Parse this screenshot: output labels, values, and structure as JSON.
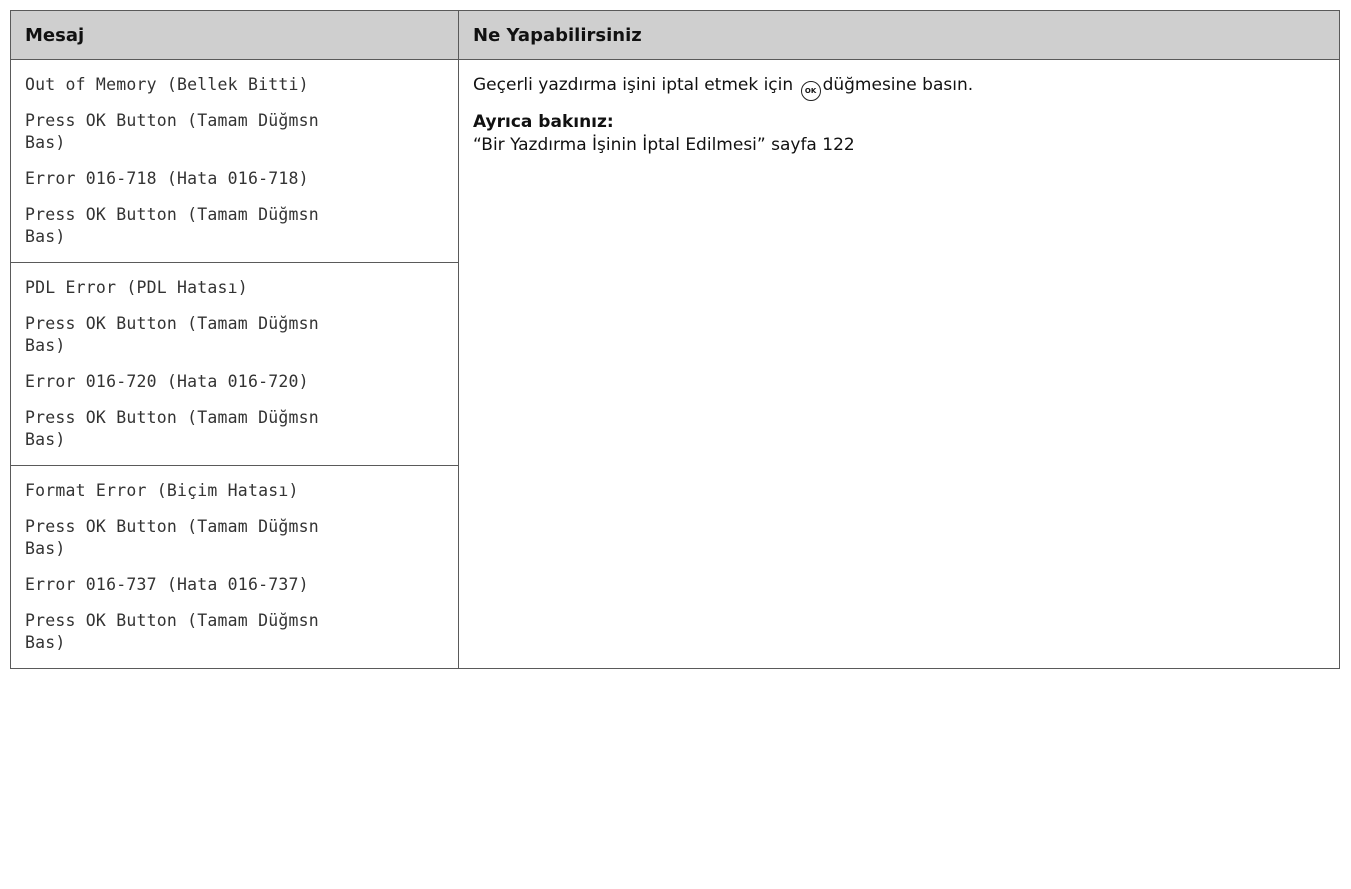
{
  "table": {
    "headers": [
      "Mesaj",
      "Ne Yapabilirsiniz"
    ],
    "groups": [
      {
        "messages": [
          "Out of Memory (Bellek Bitti)",
          "Press OK Button (Tamam Düğmsn Bas)",
          "Error 016-718 (Hata 016-718)",
          "Press OK Button (Tamam Düğmsn Bas)"
        ]
      },
      {
        "messages": [
          "PDL Error (PDL Hatası)",
          "Press OK Button (Tamam Düğmsn Bas)",
          "Error 016-720 (Hata 016-720)",
          "Press OK Button (Tamam Düğmsn Bas)"
        ]
      },
      {
        "messages": [
          "Format Error (Biçim Hatası)",
          "Press OK Button (Tamam Düğmsn Bas)",
          "Error 016-737 (Hata 016-737)",
          "Press OK Button (Tamam Düğmsn Bas)"
        ]
      }
    ],
    "action": {
      "text_before": "Geçerli yazdırma işini iptal etmek için",
      "icon": "ok-button-icon",
      "icon_label": "OK",
      "text_after": "düğmesine basın.",
      "see_also_label": "Ayrıca bakınız:",
      "see_also_link": "“Bir Yazdırma İşinin İptal Edilmesi” sayfa 122"
    }
  }
}
